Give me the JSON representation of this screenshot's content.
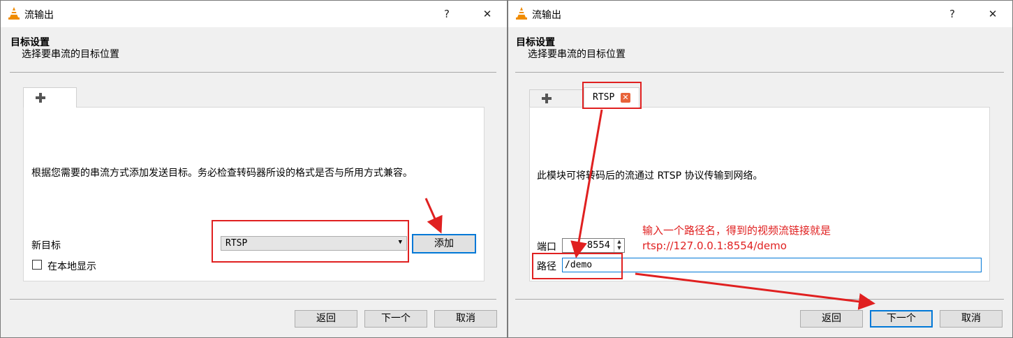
{
  "left": {
    "title": "流输出",
    "help": "?",
    "close": "✕",
    "header_title": "目标设置",
    "header_subtitle": "选择要串流的目标位置",
    "tab_plus": "+",
    "info": "根据您需要的串流方式添加发送目标。务必检查转码器所设的格式是否与所用方式兼容。",
    "new_target_label": "新目标",
    "combo_value": "RTSP",
    "add_button": "添加",
    "local_display_label": "在本地显示",
    "back_button": "返回",
    "next_button": "下一个",
    "cancel_button": "取消"
  },
  "right": {
    "title": "流输出",
    "help": "?",
    "close": "✕",
    "header_title": "目标设置",
    "header_subtitle": "选择要串流的目标位置",
    "tab_plus": "+",
    "tab_rtsp": "RTSP",
    "info": "此模块可将转码后的流通过 RTSP 协议传输到网络。",
    "port_label": "端口",
    "port_value": "8554",
    "path_label": "路径",
    "path_value": "/demo",
    "annotation_line1": "输入一个路径名，得到的视频流链接就是",
    "annotation_line2": "rtsp://127.0.0.1:8554/demo",
    "back_button": "返回",
    "next_button": "下一个",
    "cancel_button": "取消"
  },
  "colors": {
    "annotation_red": "#e02020",
    "focus_blue": "#0078d7",
    "vlc_orange": "#f08c00"
  }
}
